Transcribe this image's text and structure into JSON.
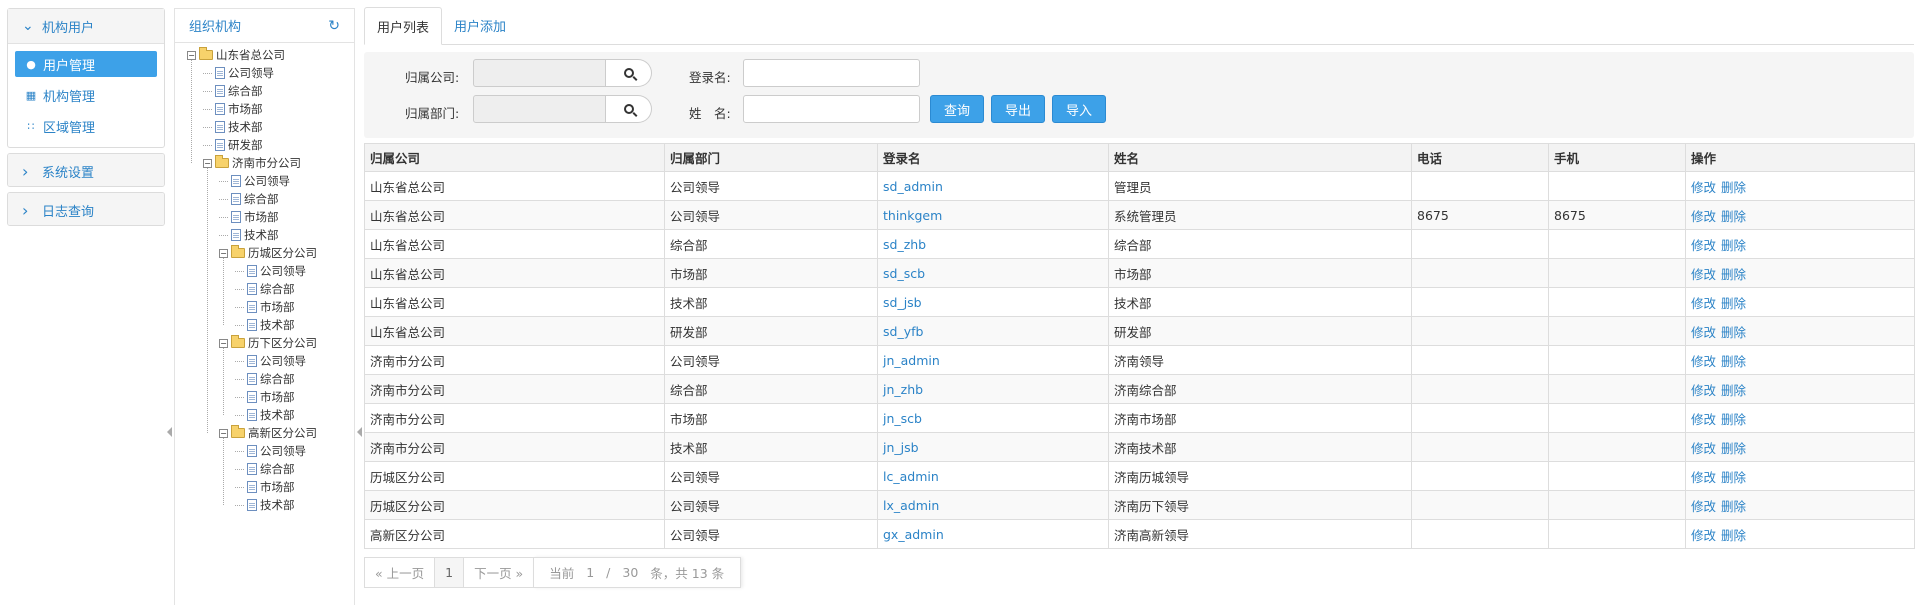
{
  "menu": {
    "groups": [
      {
        "title": "机构用户",
        "open": true,
        "items": [
          {
            "label": "用户管理",
            "icon": "user-icon",
            "active": true
          },
          {
            "label": "机构管理",
            "icon": "grid-icon",
            "active": false
          },
          {
            "label": "区域管理",
            "icon": "th-icon",
            "active": false
          }
        ]
      },
      {
        "title": "系统设置",
        "open": false
      },
      {
        "title": "日志查询",
        "open": false
      }
    ]
  },
  "tree": {
    "title": "组织机构",
    "refresh_icon": "refresh-icon",
    "root": "山东省总公司",
    "root_children": [
      "公司领导",
      "综合部",
      "市场部",
      "技术部",
      "研发部"
    ],
    "branch": "济南市分公司",
    "branch_children": [
      "公司领导",
      "综合部",
      "市场部",
      "技术部"
    ],
    "subbranches": [
      {
        "name": "历城区分公司",
        "children": [
          "公司领导",
          "综合部",
          "市场部",
          "技术部"
        ]
      },
      {
        "name": "历下区分公司",
        "children": [
          "公司领导",
          "综合部",
          "市场部",
          "技术部"
        ]
      },
      {
        "name": "高新区分公司",
        "children": [
          "公司领导",
          "综合部",
          "市场部",
          "技术部"
        ]
      }
    ]
  },
  "tabs": [
    {
      "label": "用户列表",
      "active": true
    },
    {
      "label": "用户添加",
      "active": false
    }
  ],
  "search": {
    "company_label": "归属公司:",
    "company_value": "",
    "dept_label": "归属部门:",
    "dept_value": "",
    "login_label": "登录名:",
    "login_value": "",
    "name_label": "姓　名:",
    "name_value": "",
    "query_label": "查询",
    "export_label": "导出",
    "import_label": "导入"
  },
  "table": {
    "headers": [
      "归属公司",
      "归属部门",
      "登录名",
      "姓名",
      "电话",
      "手机",
      "操作"
    ],
    "edit_label": "修改",
    "delete_label": "删除",
    "rows": [
      [
        "山东省总公司",
        "公司领导",
        "sd_admin",
        "管理员",
        "",
        ""
      ],
      [
        "山东省总公司",
        "公司领导",
        "thinkgem",
        "系统管理员",
        "8675",
        "8675"
      ],
      [
        "山东省总公司",
        "综合部",
        "sd_zhb",
        "综合部",
        "",
        ""
      ],
      [
        "山东省总公司",
        "市场部",
        "sd_scb",
        "市场部",
        "",
        ""
      ],
      [
        "山东省总公司",
        "技术部",
        "sd_jsb",
        "技术部",
        "",
        ""
      ],
      [
        "山东省总公司",
        "研发部",
        "sd_yfb",
        "研发部",
        "",
        ""
      ],
      [
        "济南市分公司",
        "公司领导",
        "jn_admin",
        "济南领导",
        "",
        ""
      ],
      [
        "济南市分公司",
        "综合部",
        "jn_zhb",
        "济南综合部",
        "",
        ""
      ],
      [
        "济南市分公司",
        "市场部",
        "jn_scb",
        "济南市场部",
        "",
        ""
      ],
      [
        "济南市分公司",
        "技术部",
        "jn_jsb",
        "济南技术部",
        "",
        ""
      ],
      [
        "历城区分公司",
        "公司领导",
        "lc_admin",
        "济南历城领导",
        "",
        ""
      ],
      [
        "历城区分公司",
        "公司领导",
        "lx_admin",
        "济南历下领导",
        "",
        ""
      ],
      [
        "高新区分公司",
        "公司领导",
        "gx_admin",
        "济南高新领导",
        "",
        ""
      ]
    ]
  },
  "pager": {
    "prev_label": "« 上一页",
    "page": "1",
    "next_label": "下一页 »",
    "current_label": "当前",
    "current_page": "1",
    "slash": "/",
    "page_size": "30",
    "suffix": "条，共 13 条"
  }
}
